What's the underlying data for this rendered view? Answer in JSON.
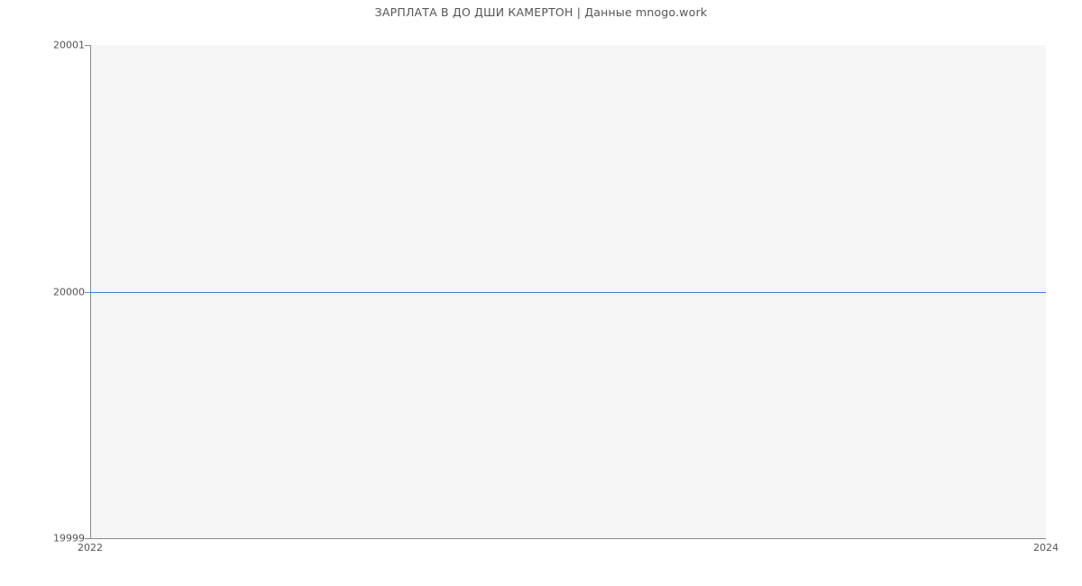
{
  "chart_data": {
    "type": "line",
    "title": "ЗАРПЛАТА В ДО ДШИ КАМЕРТОН | Данные mnogo.work",
    "x": [
      2022,
      2024
    ],
    "series": [
      {
        "name": "salary",
        "values": [
          20000,
          20000
        ],
        "color": "#4a7fd6"
      }
    ],
    "xlabel": "",
    "ylabel": "",
    "xlim": [
      2022,
      2024
    ],
    "ylim": [
      19999,
      20001
    ],
    "y_ticks": [
      19999,
      20000,
      20001
    ],
    "x_ticks": [
      2022,
      2024
    ]
  }
}
